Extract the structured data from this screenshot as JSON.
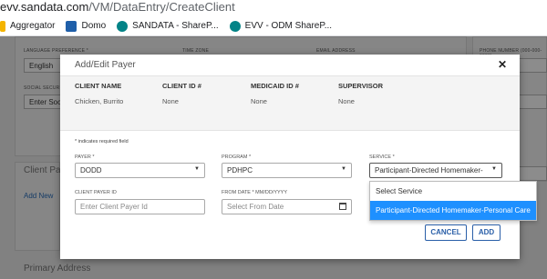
{
  "browser": {
    "url_host": "evv.sandata.com",
    "url_path": "/VM/DataEntry/CreateClient",
    "bookmarks": [
      {
        "label": "Aggregator",
        "icon": "aggregator-icon"
      },
      {
        "label": "Domo",
        "icon": "domo-icon"
      },
      {
        "label": "SANDATA - ShareP...",
        "icon": "sharepoint-icon"
      },
      {
        "label": "EVV - ODM ShareP...",
        "icon": "sharepoint-icon"
      }
    ]
  },
  "background": {
    "labels": {
      "language_preference": "LANGUAGE PREFERENCE *",
      "time_zone": "TIME ZONE",
      "email_address": "EMAIL ADDRESS",
      "phone_number": "PHONE NUMBER (000-000-0000)",
      "social_security": "SOCIAL SECURI"
    },
    "language_value": "English",
    "social_placeholder": "Enter Soc",
    "phone_placeholder": "one Num",
    "address_placeholder": "dress Line",
    "code_placeholder": "Code",
    "client_payer_heading": "Client Pay",
    "add_new_link": "Add New",
    "primary_address_heading": "Primary Address"
  },
  "modal": {
    "title": "Add/Edit Payer",
    "close_glyph": "✕",
    "info": {
      "headers": [
        "CLIENT NAME",
        "CLIENT ID #",
        "MEDICAID ID #",
        "SUPERVISOR"
      ],
      "values": [
        "Chicken, Burrito",
        "None",
        "None",
        "None"
      ]
    },
    "required_note": "* indicates required field",
    "fields": {
      "payer_label": "PAYER *",
      "payer_value": "DODD",
      "program_label": "PROGRAM *",
      "program_value": "PDHPC",
      "service_label": "SERVICE *",
      "service_value": "Participant-Directed Homemaker-",
      "client_payer_id_label": "CLIENT PAYER ID",
      "client_payer_id_placeholder": "Enter Client Payer Id",
      "from_date_label": "FROM DATE * MM/DD/YYYY",
      "from_date_placeholder": "Select From Date"
    },
    "service_dropdown": {
      "options": [
        "Select Service",
        "Participant-Directed Homemaker-Personal Care"
      ],
      "selected_index": 1
    },
    "buttons": {
      "cancel": "CANCEL",
      "add": "ADD"
    }
  },
  "colors": {
    "accent": "#2a5fa8",
    "selected_option": "#1e90ff"
  }
}
